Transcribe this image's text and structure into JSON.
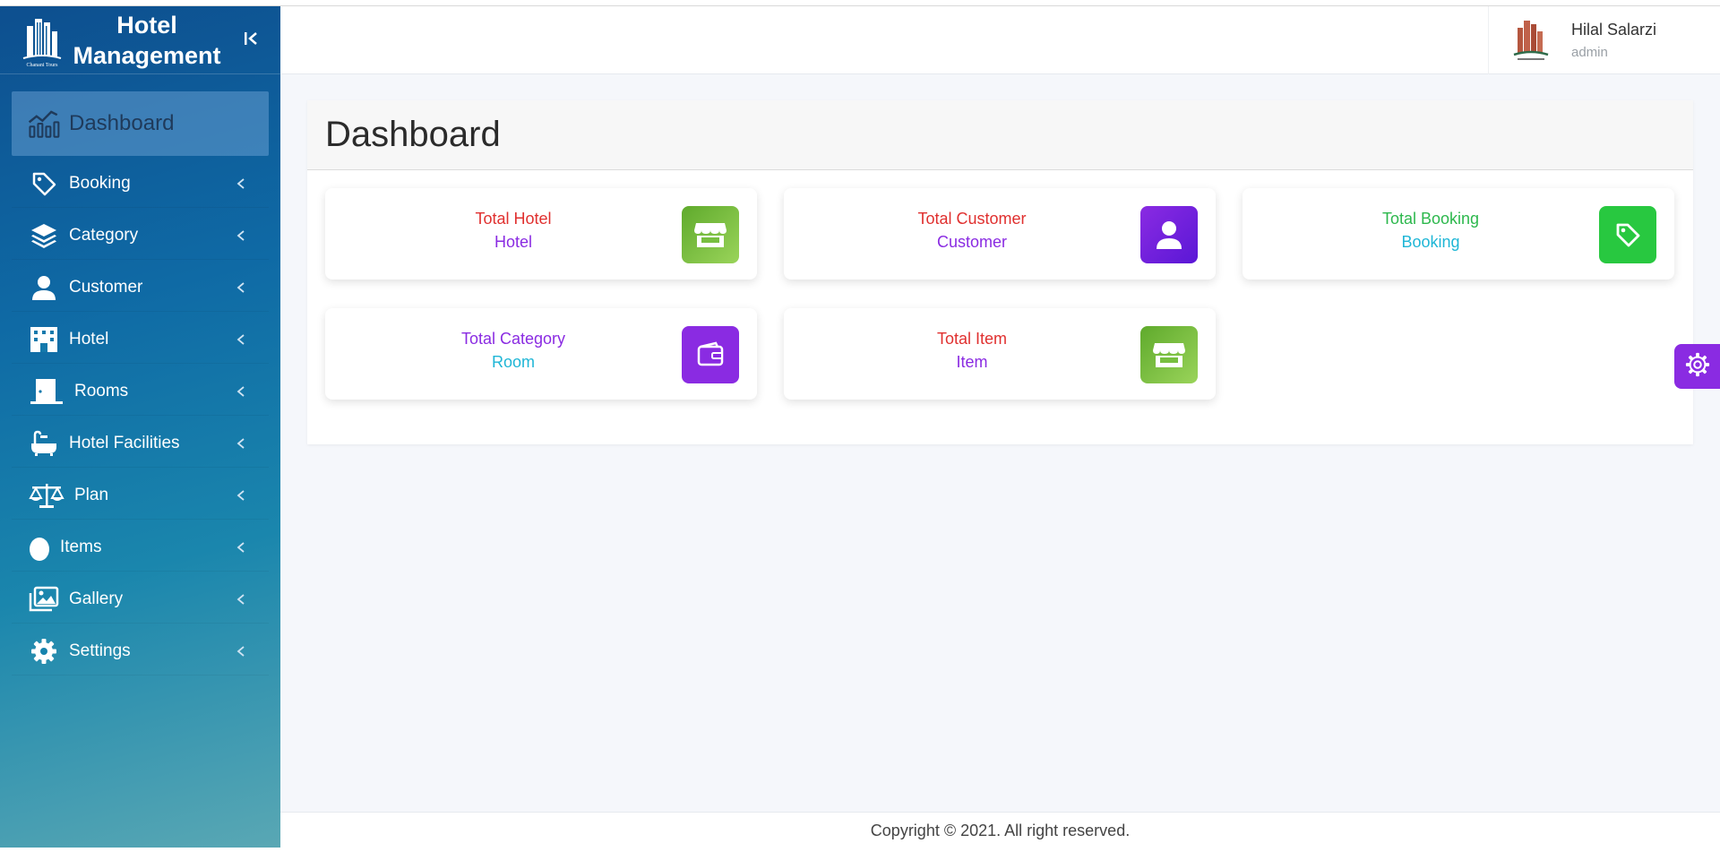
{
  "brand": {
    "title_line1": "Hotel",
    "title_line2": "Management",
    "logo_text": "Chanani Tours"
  },
  "sidebar": {
    "dashboard_label": "Dashboard",
    "items": [
      {
        "label": "Booking",
        "icon": "tag-icon"
      },
      {
        "label": "Category",
        "icon": "layers-icon"
      },
      {
        "label": "Customer",
        "icon": "user-icon"
      },
      {
        "label": "Hotel",
        "icon": "building-icon"
      },
      {
        "label": "Rooms",
        "icon": "door-icon"
      },
      {
        "label": "Hotel Facilities",
        "icon": "bathtub-icon"
      },
      {
        "label": "Plan",
        "icon": "balance-scale-icon"
      },
      {
        "label": "Items",
        "icon": "egg-icon"
      },
      {
        "label": "Gallery",
        "icon": "images-icon"
      },
      {
        "label": "Settings",
        "icon": "gear-icon"
      }
    ]
  },
  "user": {
    "name": "Hilal Salarzi",
    "role": "admin"
  },
  "page": {
    "title": "Dashboard"
  },
  "cards": [
    {
      "line1": "Total Hotel",
      "line2": "Hotel",
      "icon": "store-icon",
      "line1_color": "#e0302f",
      "line2_color": "#8a2be2"
    },
    {
      "line1": "Total Customer",
      "line2": "Customer",
      "icon": "user-icon",
      "line1_color": "#e0302f",
      "line2_color": "#8a2be2"
    },
    {
      "line1": "Total Booking",
      "line2": "Booking",
      "icon": "tag-icon",
      "line1_color": "#2db84d",
      "line2_color": "#1fb6d6"
    },
    {
      "line1": "Total Category",
      "line2": "Room",
      "icon": "wallet-icon",
      "line1_color": "#8a2be2",
      "line2_color": "#1fb6d6"
    },
    {
      "line1": "Total Item",
      "line2": "Item",
      "icon": "store-icon",
      "line1_color": "#e0302f",
      "line2_color": "#8a2be2"
    }
  ],
  "footer": {
    "text": "Copyright © 2021. All right reserved."
  },
  "colors": {
    "accent_purple": "#8a2be2",
    "green": "#2ecc40",
    "green_gradient": "#6abf3b"
  }
}
